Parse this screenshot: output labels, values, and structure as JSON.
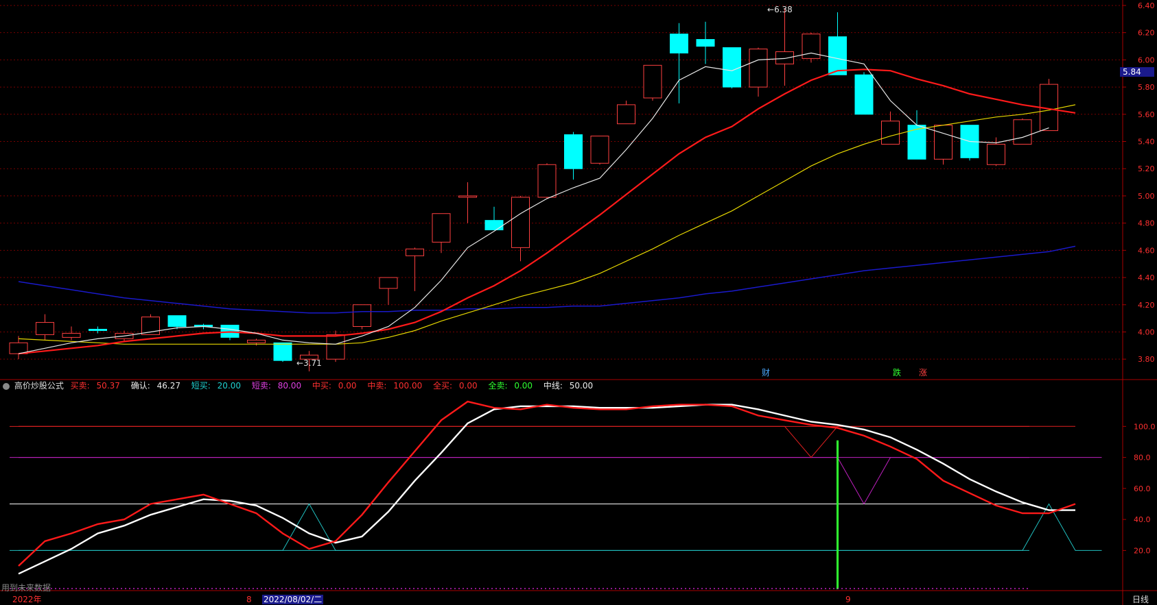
{
  "price_axis": {
    "ticks": [
      "6.40",
      "6.20",
      "6.00",
      "5.80",
      "5.60",
      "5.40",
      "5.20",
      "5.00",
      "4.80",
      "4.60",
      "4.40",
      "4.20",
      "4.00",
      "3.80"
    ],
    "tick_values": [
      6.4,
      6.2,
      6.0,
      5.8,
      5.6,
      5.4,
      5.2,
      5.0,
      4.8,
      4.6,
      4.4,
      4.2,
      4.0,
      3.8
    ],
    "current_price": "5.84",
    "range": [
      3.68,
      6.44
    ]
  },
  "indicator_axis": {
    "ticks": [
      "100.0",
      "80.0",
      "60.0",
      "40.0",
      "20.0"
    ],
    "tick_values": [
      100,
      80,
      60,
      40,
      20
    ],
    "range": [
      -5,
      124
    ]
  },
  "annotations": {
    "high": "6.38",
    "low": "3.71",
    "event_cai": "财",
    "event_die": "跌",
    "event_zhang": "涨",
    "future_data_note": "用到未来数据"
  },
  "indicator_header": {
    "name": "高价炒股公式",
    "buy_sell_label": "买卖:",
    "buy_sell_value": "50.37",
    "confirm_label": "确认:",
    "confirm_value": "46.27",
    "short_buy_label": "短买:",
    "short_buy_value": "20.00",
    "short_sell_label": "短卖:",
    "short_sell_value": "80.00",
    "mid_buy_label": "中买:",
    "mid_buy_value": "0.00",
    "mid_sell_label": "中卖:",
    "mid_sell_value": "100.00",
    "all_buy_label": "全买:",
    "all_buy_value": "0.00",
    "all_sell_label": "全卖:",
    "all_sell_value": "0.00",
    "mid_line_label": "中线:",
    "mid_line_value": "50.00"
  },
  "time_axis": {
    "year_label": "2022年",
    "month_8": "8",
    "cursor_date": "2022/08/02/二",
    "month_9": "9",
    "period_label": "日线"
  },
  "colors": {
    "up": "#ff4040",
    "down": "#00ffff",
    "ma_white": "#e8e8e8",
    "ma_red": "#ff1a1a",
    "ma_yellow": "#e6d700",
    "ma_blue": "#1a1acc",
    "grid": "#7a0000",
    "axis_text": "#ff3030"
  },
  "chart_data": {
    "type": "candlestick",
    "candles": [
      {
        "o": 3.84,
        "h": 3.97,
        "l": 3.8,
        "c": 3.92
      },
      {
        "o": 3.98,
        "h": 4.13,
        "l": 3.94,
        "c": 4.07
      },
      {
        "o": 3.96,
        "h": 4.04,
        "l": 3.94,
        "c": 3.99
      },
      {
        "o": 4.02,
        "h": 4.04,
        "l": 3.99,
        "c": 4.01
      },
      {
        "o": 3.95,
        "h": 4.01,
        "l": 3.93,
        "c": 3.99
      },
      {
        "o": 3.98,
        "h": 4.13,
        "l": 3.98,
        "c": 4.11
      },
      {
        "o": 4.12,
        "h": 4.12,
        "l": 4.02,
        "c": 4.04
      },
      {
        "o": 4.05,
        "h": 4.06,
        "l": 4.02,
        "c": 4.04
      },
      {
        "o": 4.05,
        "h": 4.05,
        "l": 3.94,
        "c": 3.96
      },
      {
        "o": 3.92,
        "h": 3.95,
        "l": 3.9,
        "c": 3.94
      },
      {
        "o": 3.92,
        "h": 3.92,
        "l": 3.78,
        "c": 3.79
      },
      {
        "o": 3.8,
        "h": 3.86,
        "l": 3.71,
        "c": 3.83
      },
      {
        "o": 3.8,
        "h": 4.01,
        "l": 3.78,
        "c": 3.98
      },
      {
        "o": 4.04,
        "h": 4.2,
        "l": 4.02,
        "c": 4.2
      },
      {
        "o": 4.32,
        "h": 4.4,
        "l": 4.2,
        "c": 4.4
      },
      {
        "o": 4.56,
        "h": 4.62,
        "l": 4.3,
        "c": 4.61
      },
      {
        "o": 4.66,
        "h": 4.87,
        "l": 4.58,
        "c": 4.87
      },
      {
        "o": 4.99,
        "h": 5.1,
        "l": 4.8,
        "c": 5.0
      },
      {
        "o": 4.82,
        "h": 4.92,
        "l": 4.75,
        "c": 4.75
      },
      {
        "o": 4.62,
        "h": 5.0,
        "l": 4.52,
        "c": 4.99
      },
      {
        "o": 4.99,
        "h": 5.24,
        "l": 4.98,
        "c": 5.23
      },
      {
        "o": 5.45,
        "h": 5.47,
        "l": 5.12,
        "c": 5.2
      },
      {
        "o": 5.24,
        "h": 5.44,
        "l": 5.23,
        "c": 5.44
      },
      {
        "o": 5.53,
        "h": 5.7,
        "l": 5.53,
        "c": 5.67
      },
      {
        "o": 5.72,
        "h": 5.96,
        "l": 5.7,
        "c": 5.96
      },
      {
        "o": 6.19,
        "h": 6.27,
        "l": 5.68,
        "c": 6.05
      },
      {
        "o": 6.15,
        "h": 6.28,
        "l": 5.97,
        "c": 6.1
      },
      {
        "o": 6.09,
        "h": 6.09,
        "l": 5.79,
        "c": 5.8
      },
      {
        "o": 5.8,
        "h": 6.09,
        "l": 5.73,
        "c": 6.08
      },
      {
        "o": 5.97,
        "h": 6.38,
        "l": 5.81,
        "c": 6.06
      },
      {
        "o": 6.01,
        "h": 6.2,
        "l": 5.98,
        "c": 6.19
      },
      {
        "o": 6.17,
        "h": 6.35,
        "l": 5.89,
        "c": 5.89
      },
      {
        "o": 5.89,
        "h": 5.91,
        "l": 5.6,
        "c": 5.6
      },
      {
        "o": 5.38,
        "h": 5.62,
        "l": 5.38,
        "c": 5.55
      },
      {
        "o": 5.52,
        "h": 5.63,
        "l": 5.27,
        "c": 5.27
      },
      {
        "o": 5.27,
        "h": 5.5,
        "l": 5.23,
        "c": 5.52
      },
      {
        "o": 5.52,
        "h": 5.52,
        "l": 5.26,
        "c": 5.28
      },
      {
        "o": 5.23,
        "h": 5.43,
        "l": 5.22,
        "c": 5.38
      },
      {
        "o": 5.38,
        "h": 5.57,
        "l": 5.38,
        "c": 5.56
      },
      {
        "o": 5.48,
        "h": 5.86,
        "l": 5.48,
        "c": 5.82
      }
    ],
    "ma_white": [
      3.84,
      3.88,
      3.92,
      3.95,
      3.97,
      4.0,
      4.03,
      4.04,
      4.02,
      3.99,
      3.94,
      3.92,
      3.91,
      3.97,
      4.04,
      4.18,
      4.38,
      4.62,
      4.74,
      4.87,
      4.98,
      5.06,
      5.13,
      5.34,
      5.57,
      5.85,
      5.95,
      5.92,
      6.0,
      6.01,
      6.05,
      6.01,
      5.97,
      5.7,
      5.52,
      5.46,
      5.4,
      5.39,
      5.43,
      5.5
    ],
    "ma_red": [
      3.84,
      3.86,
      3.88,
      3.9,
      3.93,
      3.95,
      3.97,
      3.99,
      4.0,
      3.99,
      3.97,
      3.97,
      3.97,
      3.99,
      4.02,
      4.07,
      4.15,
      4.25,
      4.34,
      4.45,
      4.58,
      4.72,
      4.86,
      5.01,
      5.16,
      5.31,
      5.43,
      5.51,
      5.64,
      5.75,
      5.85,
      5.92,
      5.93,
      5.92,
      5.86,
      5.81,
      5.75,
      5.71,
      5.67,
      5.64,
      5.61
    ],
    "ma_yellow": [
      3.95,
      3.94,
      3.93,
      3.92,
      3.91,
      3.91,
      3.91,
      3.91,
      3.91,
      3.91,
      3.91,
      3.91,
      3.91,
      3.92,
      3.96,
      4.01,
      4.08,
      4.14,
      4.2,
      4.26,
      4.31,
      4.36,
      4.43,
      4.52,
      4.61,
      4.71,
      4.8,
      4.89,
      5.0,
      5.11,
      5.22,
      5.31,
      5.38,
      5.44,
      5.49,
      5.52,
      5.55,
      5.58,
      5.6,
      5.63,
      5.67
    ],
    "ma_blue": [
      4.37,
      4.34,
      4.31,
      4.28,
      4.25,
      4.23,
      4.21,
      4.19,
      4.17,
      4.16,
      4.15,
      4.14,
      4.14,
      4.15,
      4.15,
      4.16,
      4.16,
      4.17,
      4.17,
      4.18,
      4.18,
      4.19,
      4.19,
      4.21,
      4.23,
      4.25,
      4.28,
      4.3,
      4.33,
      4.36,
      4.39,
      4.42,
      4.45,
      4.47,
      4.49,
      4.51,
      4.53,
      4.55,
      4.57,
      4.59,
      4.63
    ],
    "ind_buy_sell": [
      10,
      26,
      31,
      37,
      40,
      50,
      53,
      56,
      50,
      44,
      31,
      21,
      26,
      43,
      64,
      84,
      104,
      116,
      112,
      111,
      114,
      112,
      111,
      111,
      113,
      114,
      114,
      113,
      107,
      104,
      101,
      99,
      94,
      87,
      79,
      65,
      57,
      49,
      44,
      44,
      50
    ],
    "ind_confirm": [
      5,
      13,
      21,
      31,
      36,
      43,
      48,
      53,
      52,
      49,
      41,
      31,
      25,
      29,
      45,
      65,
      83,
      102,
      111,
      113,
      113,
      113,
      112,
      112,
      112,
      113,
      114,
      114,
      111,
      107,
      103,
      101,
      98,
      93,
      85,
      76,
      66,
      58,
      51,
      46,
      46
    ],
    "ind_short": [
      20,
      20,
      20,
      20,
      20,
      20,
      20,
      20,
      20,
      20,
      20,
      50,
      20,
      20,
      20,
      20,
      20,
      20,
      20,
      20,
      20,
      20,
      20,
      20,
      20,
      20,
      20,
      20,
      20,
      20,
      20,
      20,
      20,
      20,
      20,
      20,
      20,
      20,
      20,
      50,
      20,
      20
    ],
    "ind_magenta": [
      80,
      80,
      80,
      80,
      80,
      80,
      80,
      80,
      80,
      80,
      80,
      80,
      80,
      80,
      80,
      80,
      80,
      80,
      80,
      80,
      80,
      80,
      80,
      80,
      80,
      80,
      80,
      80,
      80,
      80,
      80,
      80,
      50,
      80,
      80,
      80,
      80,
      80,
      80,
      80,
      80,
      80
    ],
    "ind_red_thin": [
      100,
      100,
      100,
      100,
      100,
      100,
      100,
      100,
      100,
      100,
      100,
      100,
      100,
      100,
      100,
      100,
      100,
      100,
      100,
      100,
      100,
      100,
      100,
      100,
      100,
      100,
      100,
      100,
      100,
      100,
      80,
      100,
      100,
      100,
      100,
      100,
      100,
      100,
      100,
      100,
      100
    ],
    "signal_bar_index": 31,
    "signal_bar_value": 91
  }
}
